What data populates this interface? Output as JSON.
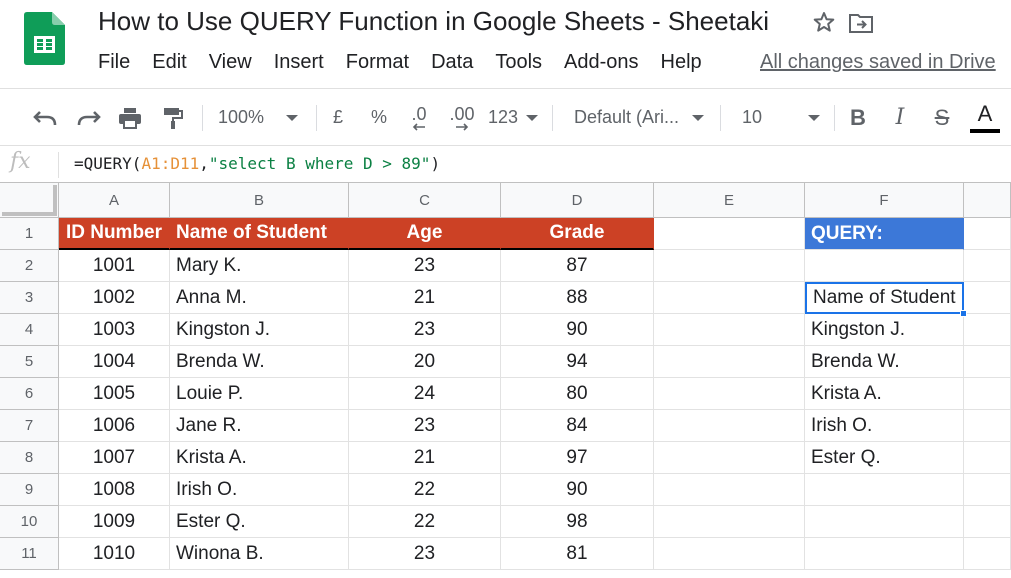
{
  "app": {
    "title": "How to Use QUERY Function in Google Sheets - Sheetaki",
    "save_status": "All changes saved in Drive"
  },
  "menu": {
    "items": [
      "File",
      "Edit",
      "View",
      "Insert",
      "Format",
      "Data",
      "Tools",
      "Add-ons",
      "Help"
    ]
  },
  "toolbar": {
    "zoom": "100%",
    "currency": "£",
    "percent": "%",
    "decrease_decimals": ".0",
    "increase_decimals": ".00",
    "more_formats": "123",
    "font": "Default (Ari...",
    "font_size": "10",
    "bold": "B",
    "italic": "I",
    "strike": "S",
    "text_color": "A"
  },
  "formula_bar": {
    "fx": "fx",
    "formula_prefix": "=QUERY(",
    "formula_ref": "A1:D11",
    "formula_comma": ",",
    "formula_string": "\"select B where D > 89\"",
    "formula_suffix": ")"
  },
  "grid": {
    "columns": [
      "A",
      "B",
      "C",
      "D",
      "E",
      "F"
    ],
    "rows": [
      "1",
      "2",
      "3",
      "4",
      "5",
      "6",
      "7",
      "8",
      "9",
      "10",
      "11"
    ],
    "header_row": [
      "ID Number",
      "Name of Student",
      "Age",
      "Grade"
    ],
    "data": [
      [
        "1001",
        "Mary K.",
        "23",
        "87"
      ],
      [
        "1002",
        "Anna M.",
        "21",
        "88"
      ],
      [
        "1003",
        "Kingston J.",
        "23",
        "90"
      ],
      [
        "1004",
        "Brenda W.",
        "20",
        "94"
      ],
      [
        "1005",
        "Louie P.",
        "24",
        "80"
      ],
      [
        "1006",
        "Jane R.",
        "23",
        "84"
      ],
      [
        "1007",
        "Krista A.",
        "21",
        "97"
      ],
      [
        "1008",
        "Irish O.",
        "22",
        "90"
      ],
      [
        "1009",
        "Ester Q.",
        "22",
        "98"
      ],
      [
        "1010",
        "Winona B.",
        "23",
        "81"
      ]
    ],
    "query_label": "QUERY:",
    "query_results": [
      "",
      "Name of Student",
      "Kingston J.",
      "Brenda W.",
      "Krista A.",
      "Irish O.",
      "Ester Q.",
      "",
      "",
      ""
    ]
  },
  "colors": {
    "header_fill": "#cc4125",
    "query_fill": "#3c78d8",
    "selection": "#1a73e8",
    "sheets_green": "#0f9d58"
  },
  "icons": [
    "sheets-logo-icon",
    "star-icon",
    "move-to-folder-icon",
    "undo-icon",
    "redo-icon",
    "print-icon",
    "paint-format-icon",
    "dropdown-caret-icon",
    "fx-icon"
  ]
}
